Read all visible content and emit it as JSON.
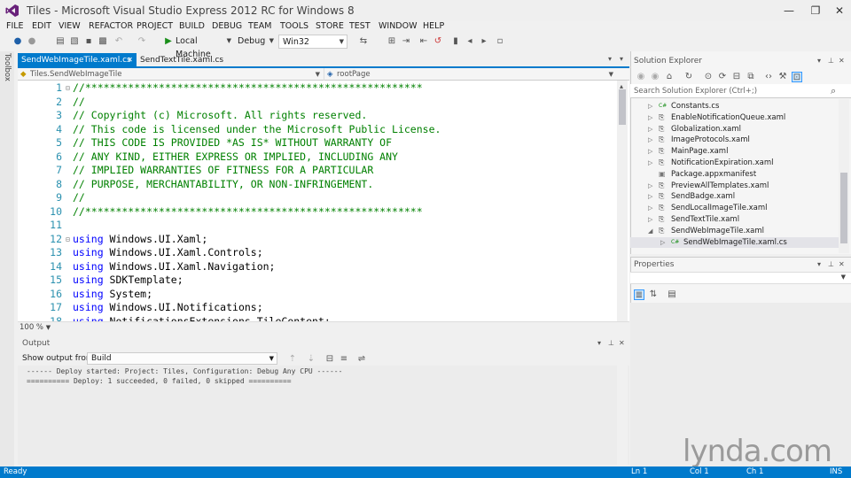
{
  "window": {
    "title": "Tiles - Microsoft Visual Studio Express 2012 RC for Windows 8",
    "min_glyph": "—",
    "max_glyph": "❐",
    "close_glyph": "✕"
  },
  "menu": [
    "FILE",
    "EDIT",
    "VIEW",
    "REFACTOR",
    "PROJECT",
    "BUILD",
    "DEBUG",
    "TEAM",
    "TOOLS",
    "STORE",
    "TEST",
    "WINDOW",
    "HELP"
  ],
  "toolbar": {
    "run_target": "Local Machine",
    "config": "Debug",
    "platform": "Win32"
  },
  "toolbox_label": "Toolbox",
  "tabs": {
    "active": "SendWebImageTile.xaml.cs",
    "inactive": "SendTextTile.xaml.cs"
  },
  "navbar": {
    "class_selector": "Tiles.SendWebImageTile",
    "member_selector": "rootPage"
  },
  "editor": {
    "zoom": "100 %",
    "lines": [
      {
        "n": "1",
        "text": "//*******************************************************",
        "kind": "cmt"
      },
      {
        "n": "2",
        "text": "//",
        "kind": "cmt"
      },
      {
        "n": "3",
        "text": "// Copyright (c) Microsoft. All rights reserved.",
        "kind": "cmt"
      },
      {
        "n": "4",
        "text": "// This code is licensed under the Microsoft Public License.",
        "kind": "cmt"
      },
      {
        "n": "5",
        "text": "// THIS CODE IS PROVIDED *AS IS* WITHOUT WARRANTY OF",
        "kind": "cmt"
      },
      {
        "n": "6",
        "text": "// ANY KIND, EITHER EXPRESS OR IMPLIED, INCLUDING ANY",
        "kind": "cmt"
      },
      {
        "n": "7",
        "text": "// IMPLIED WARRANTIES OF FITNESS FOR A PARTICULAR",
        "kind": "cmt"
      },
      {
        "n": "8",
        "text": "// PURPOSE, MERCHANTABILITY, OR NON-INFRINGEMENT.",
        "kind": "cmt"
      },
      {
        "n": "9",
        "text": "//",
        "kind": "cmt"
      },
      {
        "n": "10",
        "text": "//*******************************************************",
        "kind": "cmt"
      },
      {
        "n": "11",
        "text": "",
        "kind": "txt"
      },
      {
        "n": "12",
        "kw": "using",
        "text": " Windows.UI.Xaml;",
        "kind": "using"
      },
      {
        "n": "13",
        "kw": "using",
        "text": " Windows.UI.Xaml.Controls;",
        "kind": "using"
      },
      {
        "n": "14",
        "kw": "using",
        "text": " Windows.UI.Xaml.Navigation;",
        "kind": "using"
      },
      {
        "n": "15",
        "kw": "using",
        "text": " SDKTemplate;",
        "kind": "using"
      },
      {
        "n": "16",
        "kw": "using",
        "text": " System;",
        "kind": "using"
      },
      {
        "n": "17",
        "kw": "using",
        "text": " Windows.UI.Notifications;",
        "kind": "using"
      },
      {
        "n": "18",
        "kw": "using",
        "text": " NotificationsExtensions.TileContent;",
        "kind": "using"
      }
    ]
  },
  "output": {
    "title": "Output",
    "show_from_label": "Show output from:",
    "source": "Build",
    "lines": [
      "------ Deploy started: Project: Tiles, Configuration: Debug Any CPU ------",
      "========== Deploy: 1 succeeded, 0 failed, 0 skipped =========="
    ]
  },
  "solution_explorer": {
    "title": "Solution Explorer",
    "search_placeholder": "Search Solution Explorer (Ctrl+;)",
    "items": [
      {
        "label": "Constants.cs",
        "icon": "cs"
      },
      {
        "label": "EnableNotificationQueue.xaml",
        "icon": "xaml"
      },
      {
        "label": "Globalization.xaml",
        "icon": "xaml"
      },
      {
        "label": "ImageProtocols.xaml",
        "icon": "xaml"
      },
      {
        "label": "MainPage.xaml",
        "icon": "xaml"
      },
      {
        "label": "NotificationExpiration.xaml",
        "icon": "xaml"
      },
      {
        "label": "Package.appxmanifest",
        "icon": "manifest"
      },
      {
        "label": "PreviewAllTemplates.xaml",
        "icon": "xaml"
      },
      {
        "label": "SendBadge.xaml",
        "icon": "xaml"
      },
      {
        "label": "SendLocalImageTile.xaml",
        "icon": "xaml"
      },
      {
        "label": "SendTextTile.xaml",
        "icon": "xaml"
      },
      {
        "label": "SendWebImageTile.xaml",
        "icon": "xaml"
      },
      {
        "label": "SendWebImageTile.xaml.cs",
        "icon": "cs"
      }
    ]
  },
  "properties": {
    "title": "Properties"
  },
  "status": {
    "state": "Ready",
    "line": "Ln 1",
    "col": "Col 1",
    "ch": "Ch 1",
    "mode": "INS"
  },
  "watermark": "lynda.com"
}
